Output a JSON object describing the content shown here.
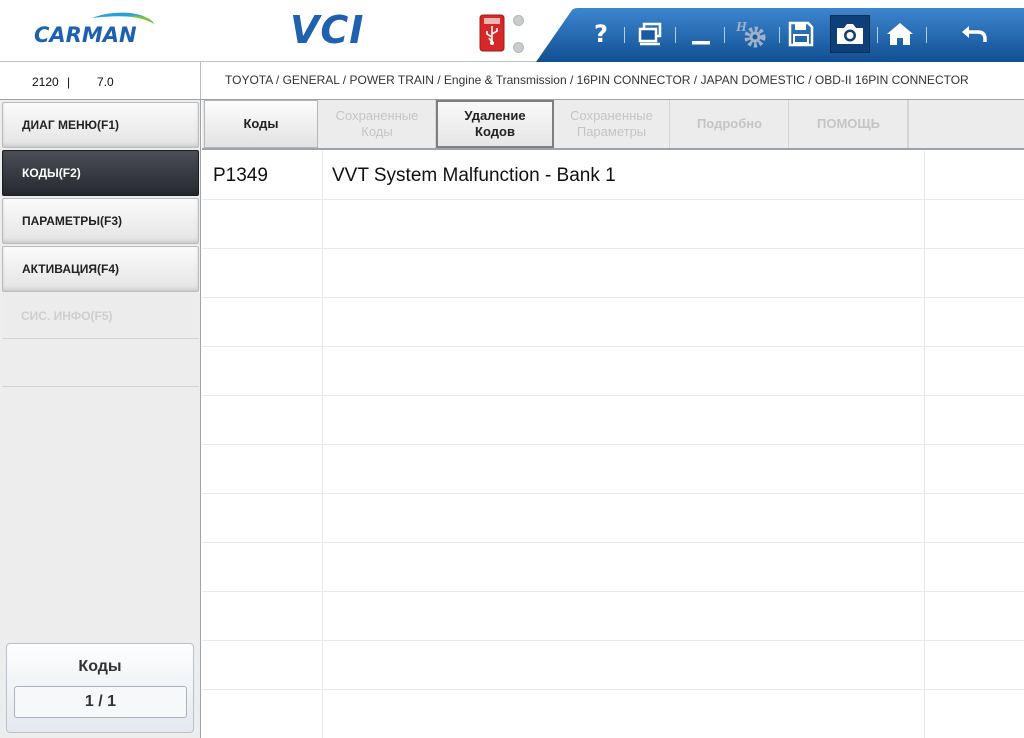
{
  "header": {
    "logo_text": "CARMAN",
    "product_title": "VCI",
    "usb_icon": "usb-icon",
    "toolbar": {
      "help": "help-icon",
      "window": "window-icon",
      "minimize": "minimize-icon",
      "settings": "settings-icon",
      "save": "save-icon",
      "capture": "camera-icon",
      "home": "home-icon",
      "back": "back-icon",
      "help_label": "?"
    }
  },
  "info": {
    "version_a": "2120",
    "version_sep": "|",
    "version_b": "7.0",
    "breadcrumb": "TOYOTA / GENERAL / POWER TRAIN / Engine & Transmission / 16PIN CONNECTOR / JAPAN DOMESTIC / OBD-II 16PIN CONNECTOR"
  },
  "sidebar": {
    "items": [
      {
        "label": "ДИАГ МЕНЮ(F1)"
      },
      {
        "label": "КОДЫ(F2)"
      },
      {
        "label": "ПАРАМЕТРЫ(F3)"
      },
      {
        "label": "АКТИВАЦИЯ(F4)"
      },
      {
        "label": "СИС. ИНФО(F5)"
      }
    ],
    "counter_title": "Коды",
    "counter_value": "1 / 1"
  },
  "tabs": [
    {
      "label": "Коды"
    },
    {
      "label_line1": "Сохраненные",
      "label_line2": "Коды"
    },
    {
      "label_line1": "Удаление",
      "label_line2": "Кодов"
    },
    {
      "label_line1": "Сохраненные",
      "label_line2": "Параметры"
    },
    {
      "label": "Подробно"
    },
    {
      "label": "ПОМОЩЬ"
    }
  ],
  "codes": [
    {
      "code": "P1349",
      "description": "VVT System Malfunction - Bank 1"
    }
  ],
  "colors": {
    "brand_blue": "#1e61b0",
    "toolbar_blue": "#1f65ae",
    "active_dark": "#2c2f35"
  }
}
